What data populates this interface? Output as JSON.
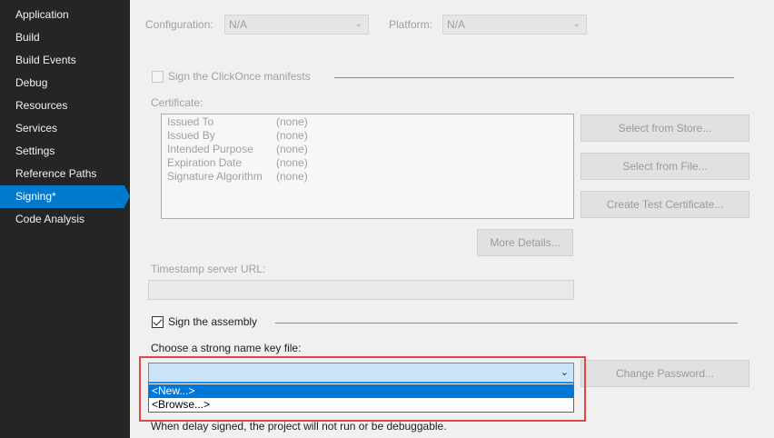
{
  "sidebar": {
    "items": [
      {
        "label": "Application"
      },
      {
        "label": "Build"
      },
      {
        "label": "Build Events"
      },
      {
        "label": "Debug"
      },
      {
        "label": "Resources"
      },
      {
        "label": "Services"
      },
      {
        "label": "Settings"
      },
      {
        "label": "Reference Paths"
      },
      {
        "label": "Signing*"
      },
      {
        "label": "Code Analysis"
      }
    ],
    "active_index": 8
  },
  "config": {
    "configuration_label": "Configuration:",
    "configuration_value": "N/A",
    "platform_label": "Platform:",
    "platform_value": "N/A"
  },
  "clickonce": {
    "sign_manifests_label": "Sign the ClickOnce manifests",
    "sign_manifests_checked": false,
    "certificate_label": "Certificate:",
    "certificate_fields": [
      {
        "key": "Issued To",
        "value": "(none)"
      },
      {
        "key": "Issued By",
        "value": "(none)"
      },
      {
        "key": "Intended Purpose",
        "value": "(none)"
      },
      {
        "key": "Expiration Date",
        "value": "(none)"
      },
      {
        "key": "Signature Algorithm",
        "value": "(none)"
      }
    ],
    "select_from_store": "Select from Store...",
    "select_from_file": "Select from File...",
    "create_test_certificate": "Create Test Certificate...",
    "more_details": "More Details...",
    "timestamp_label": "Timestamp server URL:",
    "timestamp_value": ""
  },
  "assembly": {
    "sign_assembly_label": "Sign the assembly",
    "sign_assembly_checked": true,
    "key_file_label": "Choose a strong name key file:",
    "key_file_value": "",
    "change_password": "Change Password...",
    "dropdown_options": [
      {
        "label": "<New...>",
        "selected": true
      },
      {
        "label": "<Browse...>",
        "selected": false
      }
    ],
    "delay_sign_note": "When delay signed, the project will not run or be debuggable."
  },
  "colors": {
    "sidebar_bg": "#252526",
    "accent": "#007acc",
    "selection": "#0078d7",
    "highlight_box": "#e04848"
  }
}
